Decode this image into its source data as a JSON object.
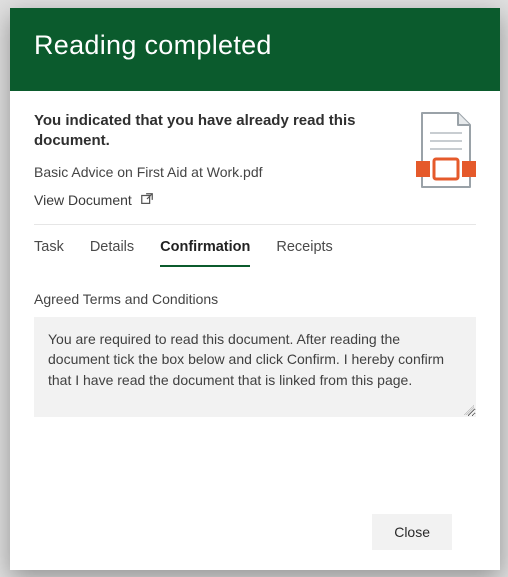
{
  "header": {
    "title": "Reading completed"
  },
  "summary": {
    "lead": "You indicated that you have already read this document.",
    "filename": "Basic Advice on First Aid at Work.pdf",
    "view_label": "View Document"
  },
  "tabs": [
    {
      "label": "Task"
    },
    {
      "label": "Details"
    },
    {
      "label": "Confirmation"
    },
    {
      "label": "Receipts"
    }
  ],
  "active_tab_index": 2,
  "section_label": "Agreed Terms and Conditions",
  "terms_text": "You are required to read this document. After reading the document tick the box below and click Confirm. I hereby confirm that I have read the document that is linked from this page.",
  "footer": {
    "close_label": "Close"
  },
  "colors": {
    "brand": "#0b5b2d",
    "accent": "#e55a2b"
  }
}
